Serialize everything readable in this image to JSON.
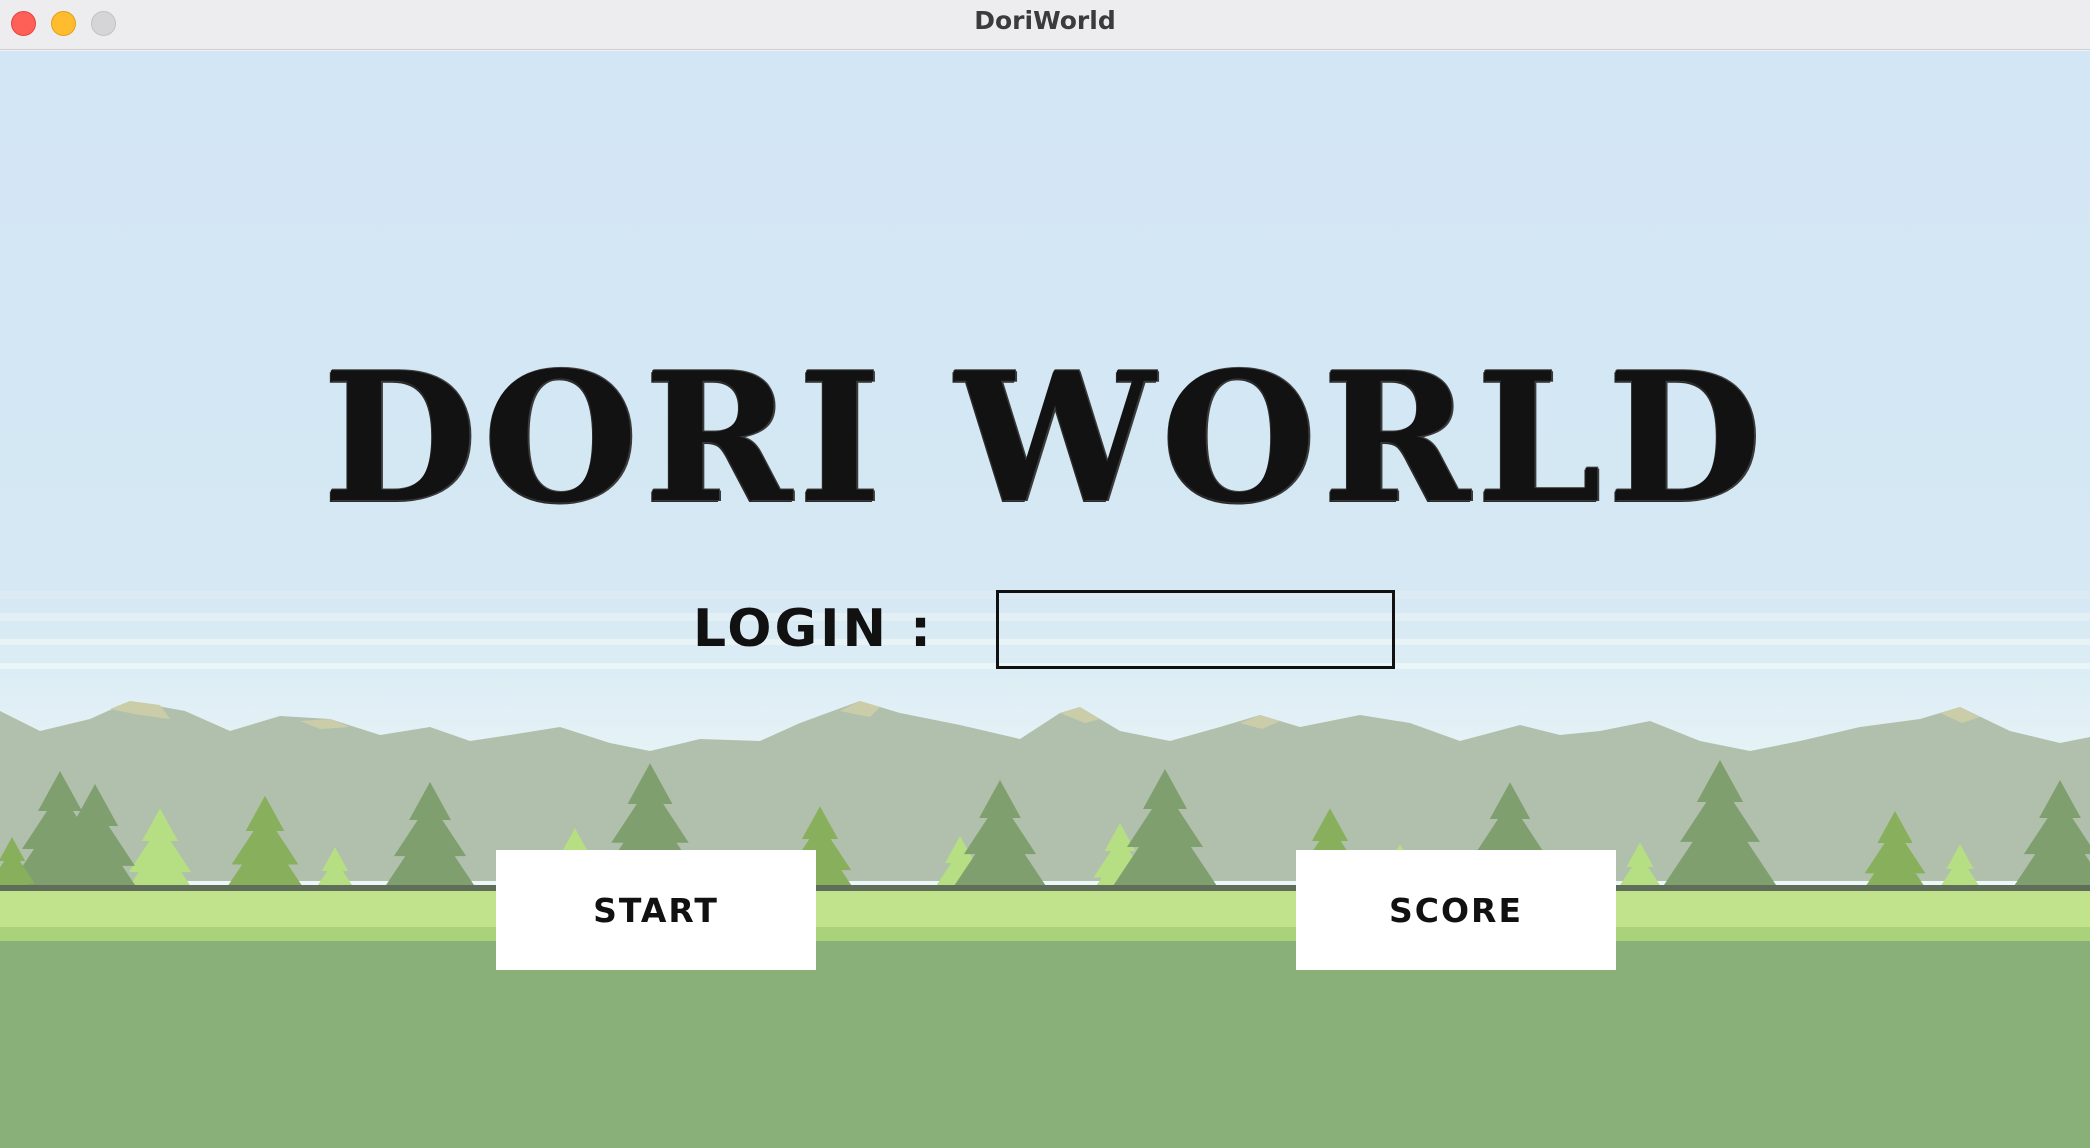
{
  "window": {
    "title": "DoriWorld"
  },
  "game": {
    "title": "DORI WORLD",
    "login_label": "LOGIN :",
    "login_value": "",
    "login_placeholder": "",
    "start_label": "START",
    "score_label": "SCORE"
  },
  "colors": {
    "sky": "#d3e6f5",
    "haze": "#eef7f8",
    "mountain": "#b0c0ad",
    "mountain_peak": "#cbcda9",
    "tree_dark": "#7f9f6f",
    "tree_mid": "#88b05c",
    "tree_light": "#b6de82",
    "grass_strip": "#c0e38c",
    "ground": "#88b078",
    "button_bg": "#ffffff",
    "text": "#111111"
  }
}
